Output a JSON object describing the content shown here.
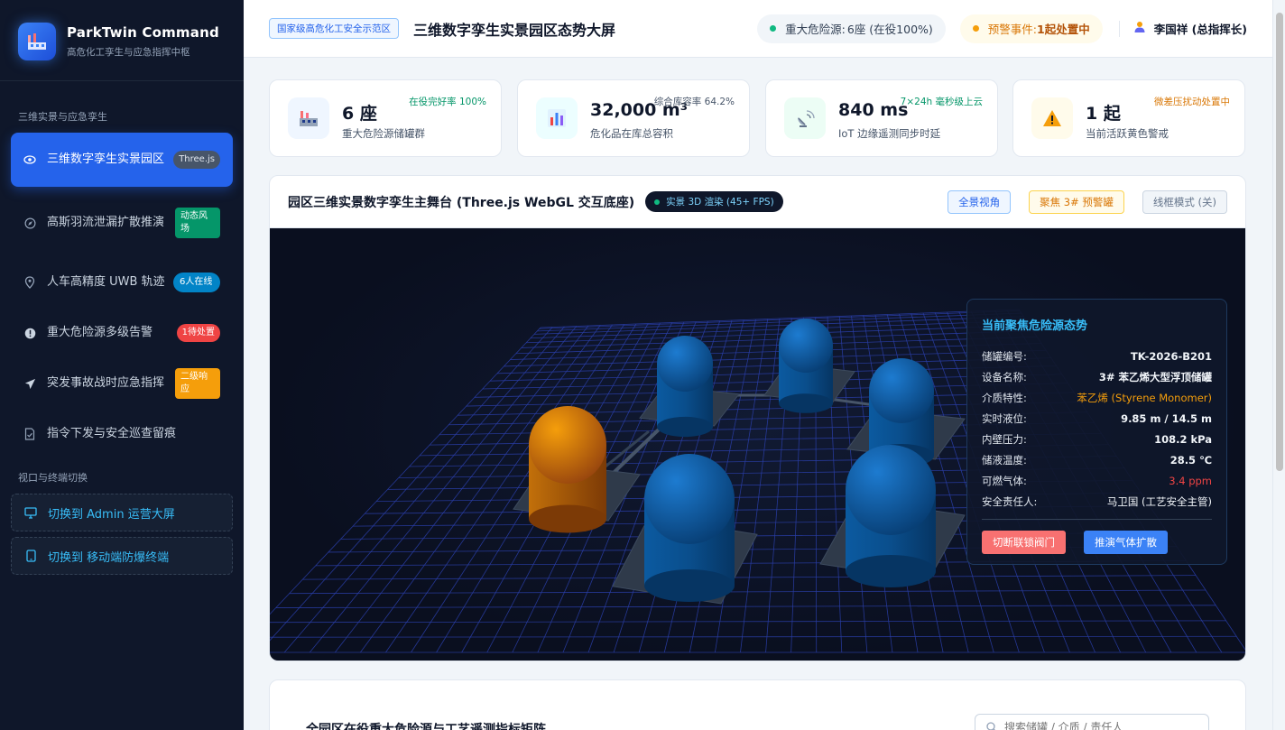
{
  "brand": {
    "title": "ParkTwin Command",
    "subtitle": "高危化工孪生与应急指挥中枢",
    "logo_icon": "factory-icon"
  },
  "sidebar": {
    "section1": "三维实景与应急孪生",
    "items": [
      {
        "label": "三维数字孪生实景园区",
        "badge": "Three.js",
        "icon": "eye-icon",
        "active": true
      },
      {
        "label": "高斯羽流泄漏扩散推演",
        "badge": "动态风场",
        "icon": "compass-icon"
      },
      {
        "label": "人车高精度 UWB 轨迹",
        "badge": "6人在线",
        "icon": "location-pin-icon"
      },
      {
        "label": "重大危险源多级告警",
        "badge": "1待处置",
        "icon": "alert-circle-icon"
      },
      {
        "label": "突发事故战时应急指挥",
        "badge": "二级响应",
        "icon": "send-icon"
      },
      {
        "label": "指令下发与安全巡查留痕",
        "badge": "",
        "icon": "document-check-icon"
      }
    ],
    "section2": "视口与终端切换",
    "switches": [
      {
        "label": "切换到 Admin 运营大屏",
        "icon": "monitor-icon"
      },
      {
        "label": "切换到 移动端防爆终端",
        "icon": "mobile-icon"
      }
    ]
  },
  "header": {
    "tag": "国家级高危化工安全示范区",
    "title": "三维数字孪生实景园区态势大屏",
    "hazard_prefix": "重大危险源: ",
    "hazard_value": "6座 (在役100%)",
    "alert_prefix": "预警事件: ",
    "alert_value": "1起处置中",
    "user": "李国祥 (总指挥长)"
  },
  "kpis": [
    {
      "value": "6 座",
      "label": "重大危险源储罐群",
      "note": "在役完好率 100%",
      "icon": "factory-icon"
    },
    {
      "value": "32,000 m³",
      "label": "危化品在库总容积",
      "note": "综合库容率 64.2%",
      "icon": "bar-chart-icon"
    },
    {
      "value": "840 ms",
      "label": "IoT 边缘遥测同步时延",
      "note": "7×24h 毫秒级上云",
      "icon": "satellite-dish-icon"
    },
    {
      "value": "1 起",
      "label": "当前活跃黄色警戒",
      "note": "微差压扰动处置中",
      "icon": "warning-icon"
    }
  ],
  "stage": {
    "title": "园区三维实景数字孪生主舞台 (Three.js WebGL 交互底座)",
    "render_status": "实景 3D 渲染 (45+ FPS)",
    "controls": [
      "全景视角",
      "聚焦 3# 预警罐",
      "线框模式 (关)"
    ]
  },
  "panel": {
    "title": "当前聚焦危险源态势",
    "rows": [
      {
        "key": "储罐编号:",
        "value": "TK-2026-B201"
      },
      {
        "key": "设备名称:",
        "value": "3# 苯乙烯大型浮顶储罐"
      },
      {
        "key": "介质特性:",
        "value": "苯乙烯 (Styrene Monomer)"
      },
      {
        "key": "实时液位:",
        "value": "9.85 m / 14.5 m"
      },
      {
        "key": "内壁压力:",
        "value": "108.2 kPa"
      },
      {
        "key": "储液温度:",
        "value": "28.5 ℃"
      },
      {
        "key": "可燃气体:",
        "value": "3.4 ppm"
      },
      {
        "key": "安全责任人:",
        "value": "马卫国 (工艺安全主管)"
      }
    ],
    "actions": [
      "切断联锁阀门",
      "推演气体扩散"
    ]
  },
  "matrix": {
    "title": "全园区在役重大危险源与工艺遥测指标矩阵",
    "search_placeholder": "搜索储罐 / 介质 / 责任人"
  },
  "colors": {
    "accent": "#2563eb",
    "warn": "#f59e0b",
    "danger": "#ef4444",
    "ok": "#10b981",
    "tank_blue": "#0b5aa0",
    "tank_alert": "#d97706"
  }
}
